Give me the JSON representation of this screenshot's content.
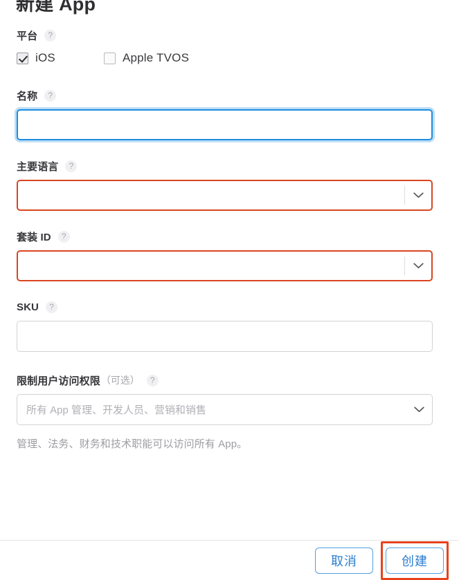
{
  "dialog": {
    "title": "新建 App"
  },
  "platform": {
    "label": "平台",
    "help": "?",
    "options": [
      {
        "label": "iOS",
        "checked": true
      },
      {
        "label": "Apple TVOS",
        "checked": false
      }
    ]
  },
  "name": {
    "label": "名称",
    "help": "?",
    "value": "",
    "placeholder": ""
  },
  "primary_language": {
    "label": "主要语言",
    "help": "?",
    "value": "",
    "placeholder": ""
  },
  "bundle_id": {
    "label": "套装 ID",
    "help": "?",
    "value": "",
    "placeholder": ""
  },
  "sku": {
    "label": "SKU",
    "help": "?",
    "value": "",
    "placeholder": ""
  },
  "user_access": {
    "label": "限制用户访问权限",
    "optional": "（可选）",
    "help": "?",
    "placeholder": "所有 App 管理、开发人员、营销和销售",
    "helper_text": "管理、法务、财务和技术职能可以访问所有 App。"
  },
  "footer": {
    "cancel_label": "取消",
    "create_label": "创建"
  },
  "colors": {
    "focus_blue": "#1f8ce0",
    "error_red": "#d9451f",
    "annotation_red": "#e8421c",
    "button_blue": "#2b7dd0",
    "border_gray": "#d2d2d7",
    "text_dark": "#333336",
    "text_muted": "#9d9da2"
  }
}
